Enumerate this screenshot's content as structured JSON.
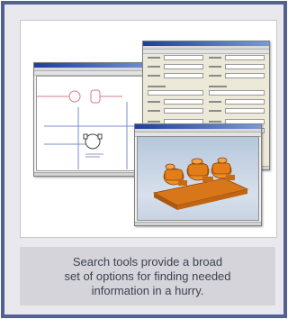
{
  "figure": {
    "caption_lines": [
      "Search tools provide a broad",
      "set of options for finding needed",
      "information in a hurry."
    ]
  },
  "colors": {
    "frame_border": "#52618f",
    "frame_fill": "#e9e9ed",
    "caption_fill": "#d4d4da",
    "caption_text": "#3e4150",
    "window_title": "#1d3f9c",
    "part_orange": "#e27d17"
  }
}
